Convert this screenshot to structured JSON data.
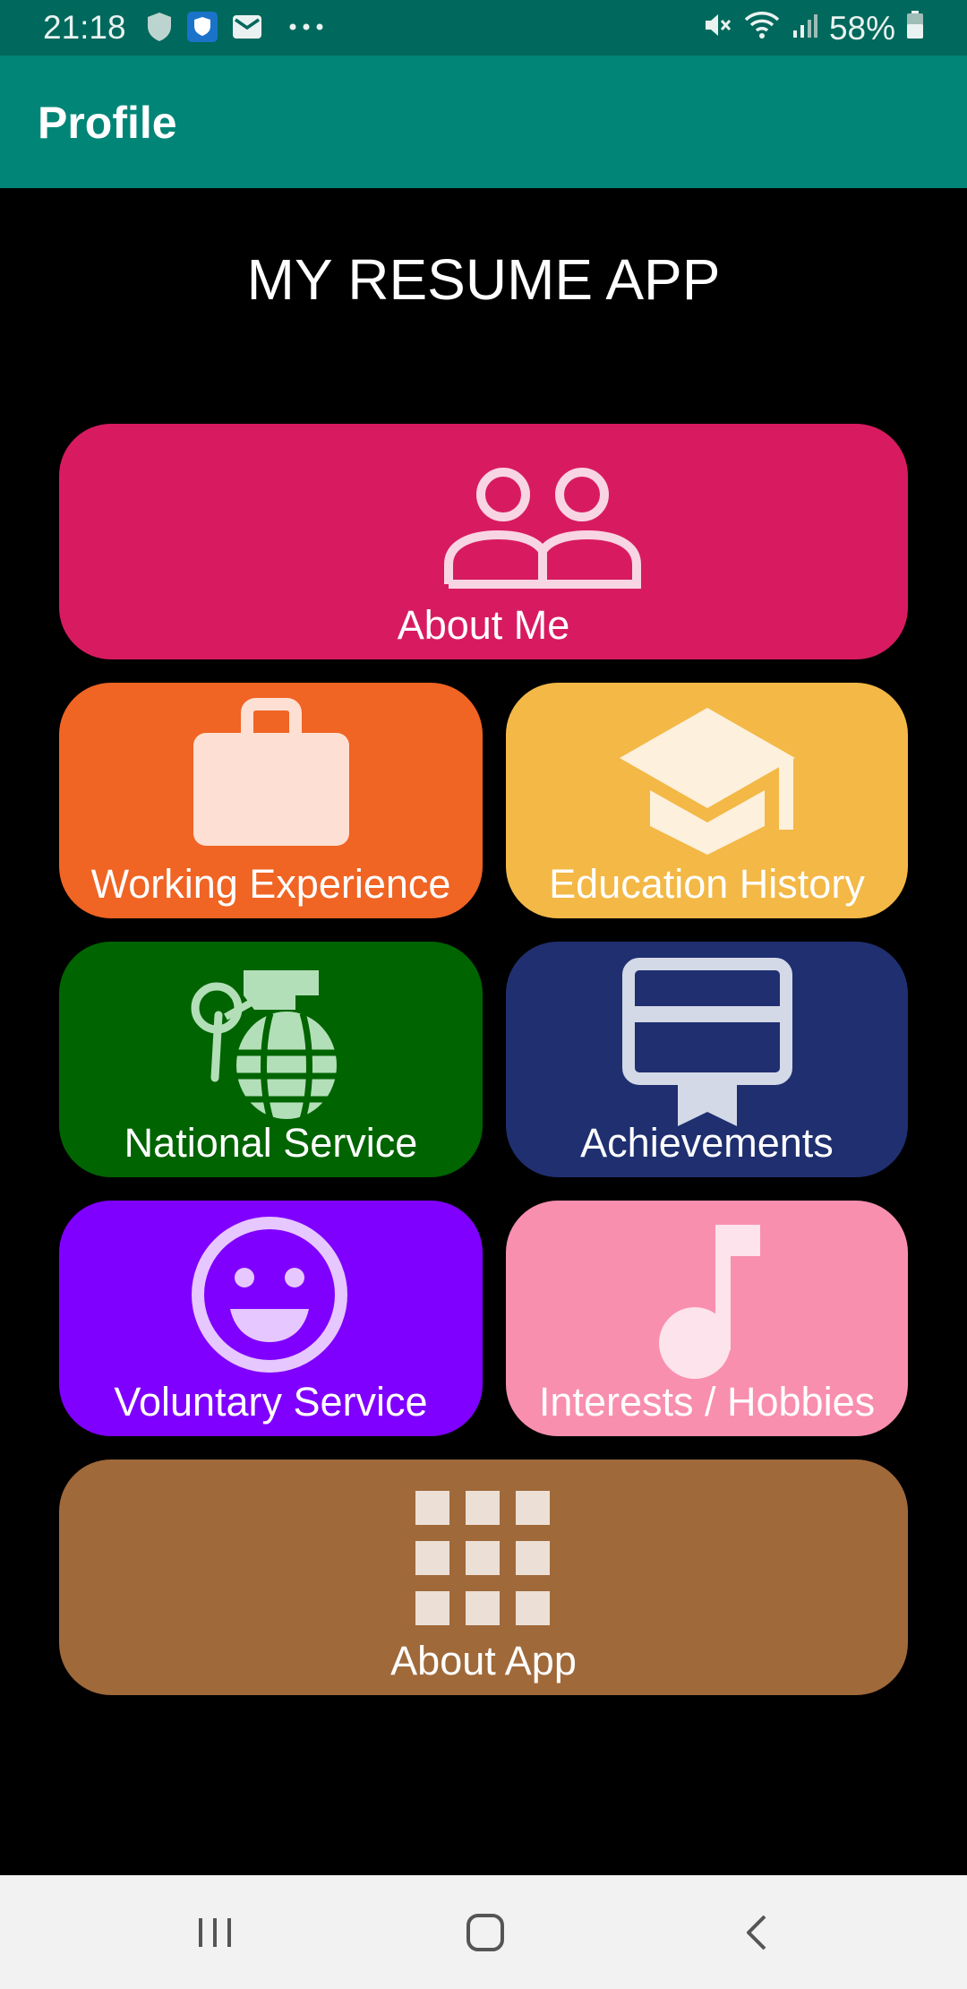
{
  "status_bar": {
    "time": "21:18",
    "battery": "58%",
    "left_icons": [
      "shield-icon",
      "vpn-shield-icon",
      "mail-icon",
      "more-dots-icon"
    ],
    "right_icons": [
      "mute-icon",
      "wifi-icon",
      "signal-icon",
      "battery-icon"
    ]
  },
  "app_bar": {
    "title": "Profile",
    "color": "#008577"
  },
  "heading": "MY RESUME APP",
  "tiles": {
    "about_me": {
      "label": "About Me",
      "icon": "people-icon",
      "color": "#d81b60"
    },
    "working_experience": {
      "label": "Working Experience",
      "icon": "briefcase-icon",
      "color": "#f06424"
    },
    "education_history": {
      "label": "Education History",
      "icon": "graduation-cap-icon",
      "color": "#f3b846"
    },
    "national_service": {
      "label": "National Service",
      "icon": "grenade-icon",
      "color": "#006400"
    },
    "achievements": {
      "label": "Achievements",
      "icon": "certificate-icon",
      "color": "#1f2f70"
    },
    "voluntary_service": {
      "label": "Voluntary Service",
      "icon": "smiley-icon",
      "color": "#8000ff"
    },
    "interests_hobbies": {
      "label": "Interests / Hobbies",
      "icon": "music-note-icon",
      "color": "#f88faf"
    },
    "about_app": {
      "label": "About App",
      "icon": "apps-grid-icon",
      "color": "#a0693a"
    }
  },
  "nav_bar": {
    "icons": [
      "recent-apps-icon",
      "home-icon",
      "back-icon"
    ]
  }
}
